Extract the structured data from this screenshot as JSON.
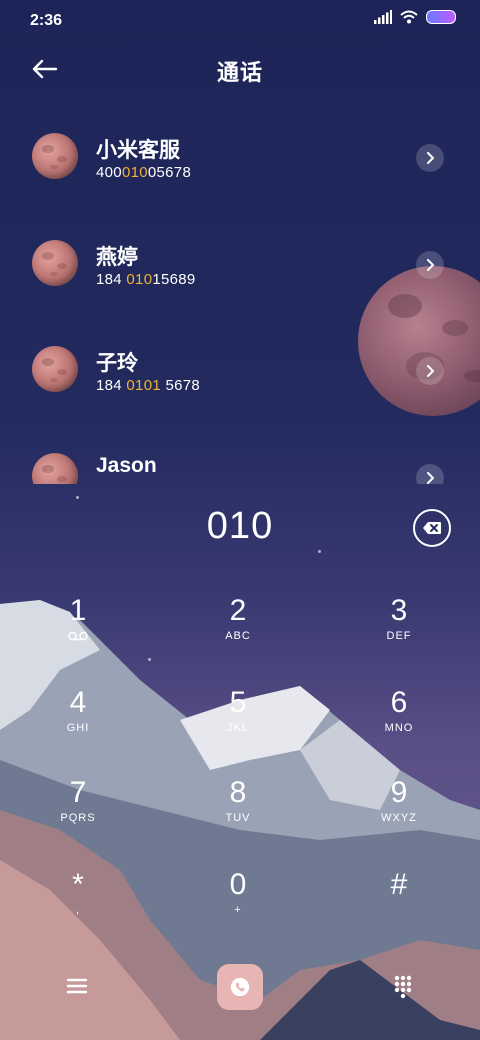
{
  "status_bar": {
    "time": "2:36",
    "icons": [
      "signal-icon",
      "wifi-icon",
      "battery-icon"
    ]
  },
  "header": {
    "title": "通话",
    "back_icon": "back-arrow-icon"
  },
  "contacts": [
    {
      "name": "小米客服",
      "number_pre": "400",
      "number_match": "010",
      "number_post": "05678"
    },
    {
      "name": "燕婷",
      "number_pre": "184 ",
      "number_match": "010",
      "number_post": "15689"
    },
    {
      "name": "子玲",
      "number_pre": "184 ",
      "number_match": "0101",
      "number_post": " 5678"
    },
    {
      "name": "Jason",
      "number_pre": "",
      "number_match": "",
      "number_post": ""
    }
  ],
  "dial": {
    "input": "010",
    "delete_icon": "backspace-icon"
  },
  "keypad": [
    {
      "digit": "1",
      "letters": "",
      "sub_icon": "voicemail-icon"
    },
    {
      "digit": "2",
      "letters": "ABC"
    },
    {
      "digit": "3",
      "letters": "DEF"
    },
    {
      "digit": "4",
      "letters": "GHI"
    },
    {
      "digit": "5",
      "letters": "JKL"
    },
    {
      "digit": "6",
      "letters": "MNO"
    },
    {
      "digit": "7",
      "letters": "PQRS"
    },
    {
      "digit": "8",
      "letters": "TUV"
    },
    {
      "digit": "9",
      "letters": "WXYZ"
    },
    {
      "digit": "*",
      "letters": ","
    },
    {
      "digit": "0",
      "letters": "+"
    },
    {
      "digit": "#",
      "letters": ""
    }
  ],
  "bottom_bar": {
    "menu_icon": "menu-icon",
    "call_icon": "phone-icon",
    "dialpad_icon": "dialpad-icon"
  },
  "colors": {
    "highlight": "#f2b234",
    "call_button": "#e8b5b5",
    "background_top": "#1d2558"
  }
}
